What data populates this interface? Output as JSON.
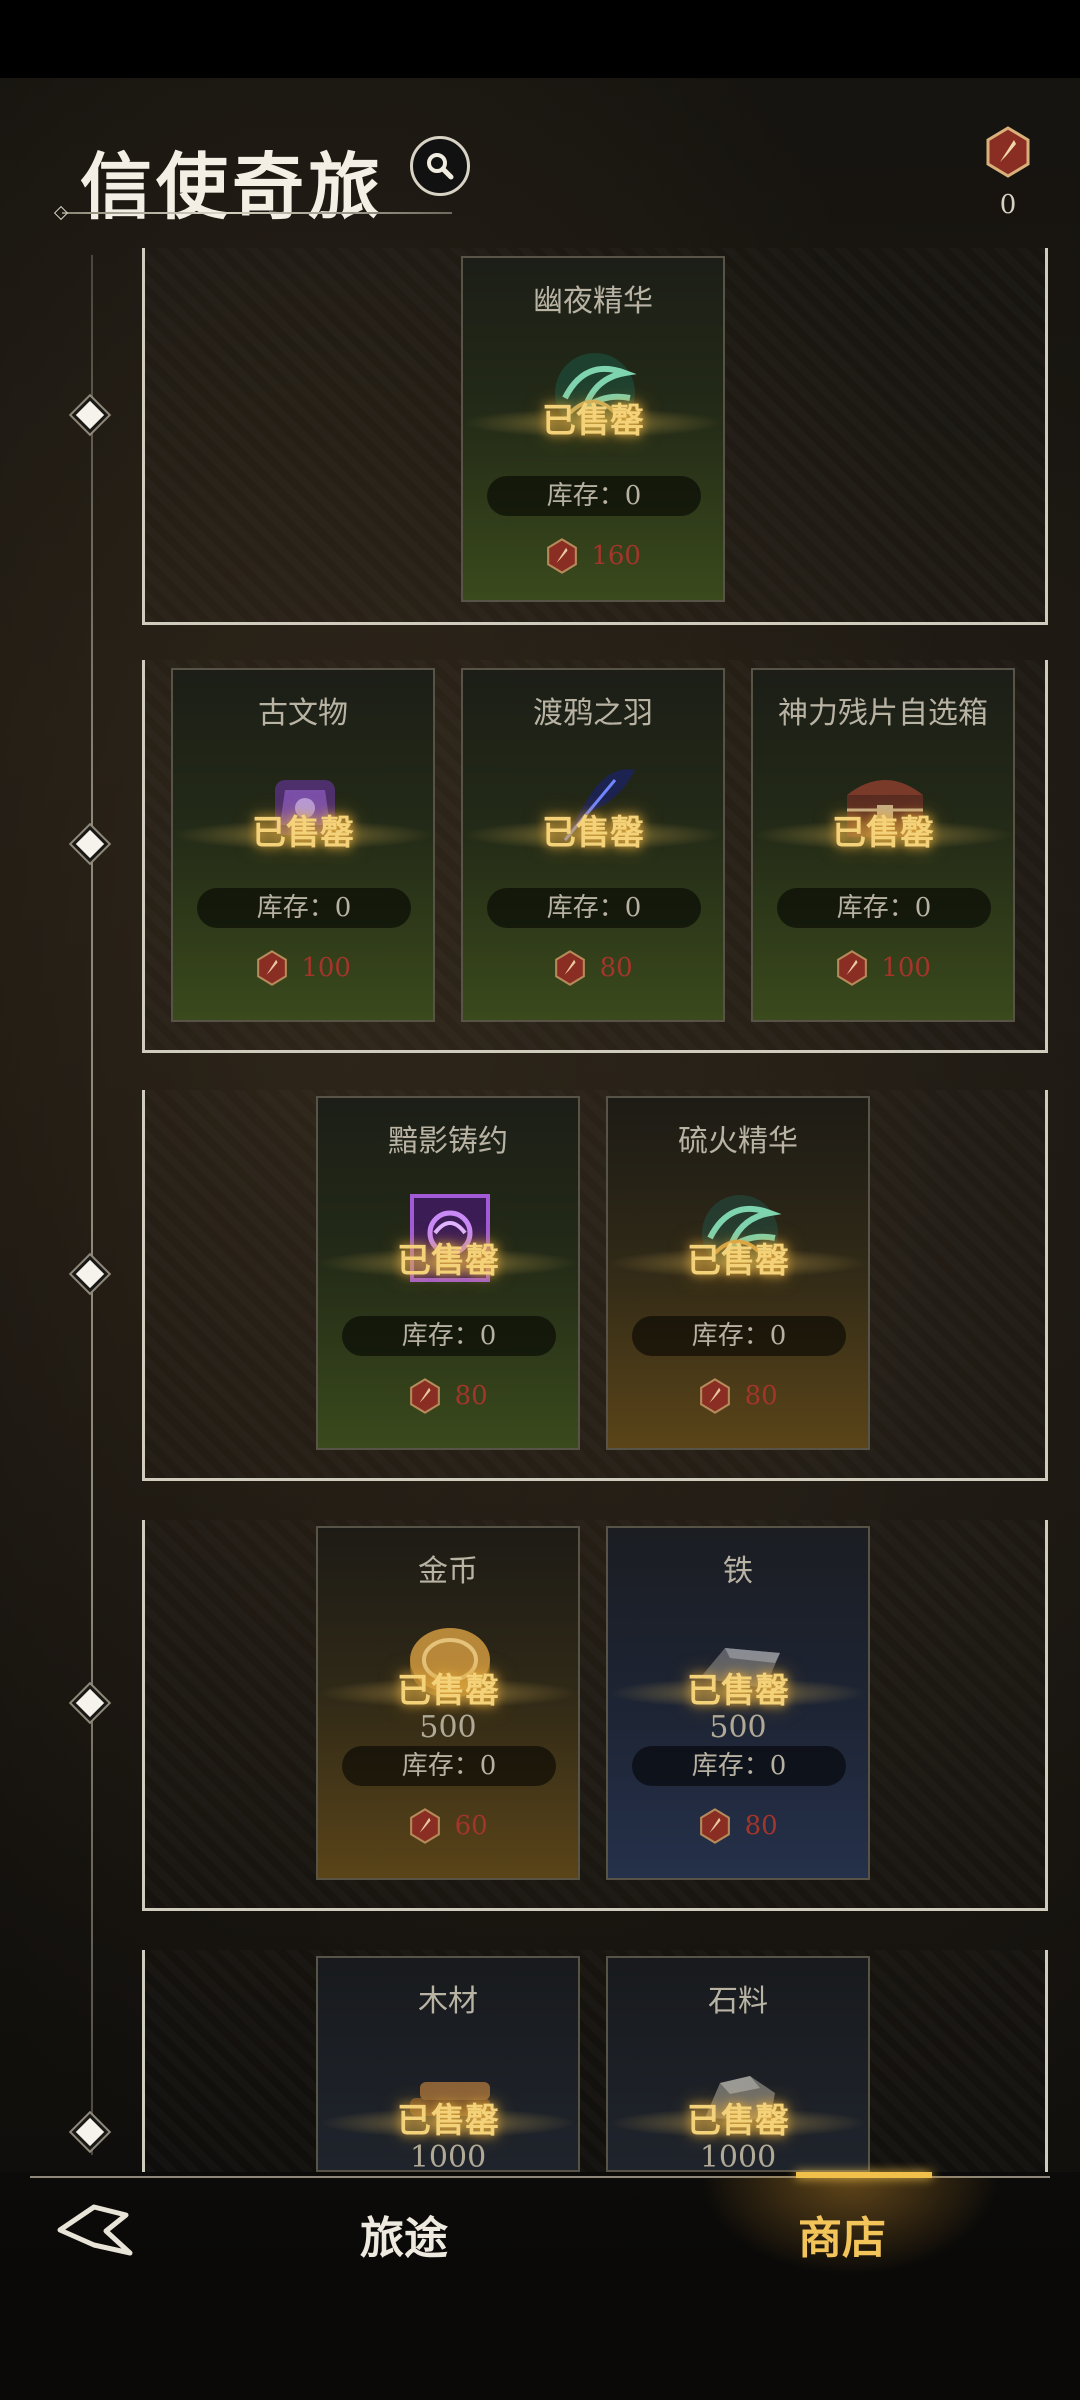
{
  "header": {
    "title": "信使奇旅",
    "currency_count": "0"
  },
  "common": {
    "sold_out": "已售罄",
    "stock_label": "库存：0"
  },
  "tiers": [
    {
      "items": [
        {
          "name": "幽夜精华",
          "price": "160",
          "amount": "",
          "icon": "green-swirl-icon"
        }
      ]
    },
    {
      "items": [
        {
          "name": "古文物",
          "price": "100",
          "amount": "",
          "icon": "artifact-icon"
        },
        {
          "name": "渡鸦之羽",
          "price": "80",
          "amount": "",
          "icon": "feather-icon"
        },
        {
          "name": "神力残片自选箱",
          "price": "100",
          "amount": "",
          "icon": "chest-icon"
        }
      ]
    },
    {
      "items": [
        {
          "name": "黯影铸约",
          "price": "80",
          "amount": "",
          "icon": "purple-seal-icon"
        },
        {
          "name": "硫火精华",
          "price": "80",
          "amount": "",
          "icon": "green-swirl-icon"
        }
      ]
    },
    {
      "items": [
        {
          "name": "金币",
          "price": "60",
          "amount": "500",
          "icon": "gold-coin-icon"
        },
        {
          "name": "铁",
          "price": "80",
          "amount": "500",
          "icon": "iron-ingot-icon"
        }
      ]
    },
    {
      "items": [
        {
          "name": "木材",
          "price": "",
          "amount": "1000",
          "icon": "wood-icon"
        },
        {
          "name": "石料",
          "price": "",
          "amount": "1000",
          "icon": "stone-icon"
        }
      ]
    }
  ],
  "nav": {
    "journey_label": "旅途",
    "shop_label": "商店"
  },
  "colors": {
    "sold_out": "#f4d27a",
    "price": "#a3352a",
    "active_tab": "#f2c45a"
  }
}
